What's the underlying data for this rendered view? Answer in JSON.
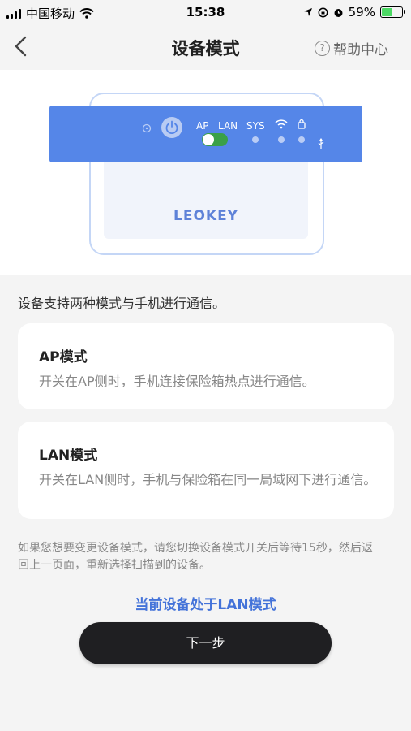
{
  "status_bar": {
    "carrier": "中国移动",
    "time": "15:38",
    "battery": "59%",
    "battery_level": 0.59
  },
  "nav": {
    "title": "设备模式",
    "help_label": "帮助中心",
    "help_icon_glyph": "?"
  },
  "device": {
    "brand": "LEOKEY",
    "labels": {
      "ap": "AP",
      "lan": "LAN",
      "sys": "SYS"
    },
    "switch_position": "AP",
    "colors": {
      "panel": "#5586e8",
      "switch": "#3aa048",
      "outline": "#c4d6f6"
    }
  },
  "intro": "设备支持两种模式与手机进行通信。",
  "modes": [
    {
      "title": "AP模式",
      "desc": "开关在AP侧时，手机连接保险箱热点进行通信。"
    },
    {
      "title": "LAN模式",
      "desc": "开关在LAN侧时，手机与保险箱在同一局域网下进行通信。"
    }
  ],
  "note": "如果您想要变更设备模式，请您切换设备模式开关后等待15秒，然后返回上一页面，重新选择扫描到的设备。",
  "current_mode": "当前设备处于LAN模式",
  "next_button": "下一步",
  "accent_color": "#4473d9"
}
